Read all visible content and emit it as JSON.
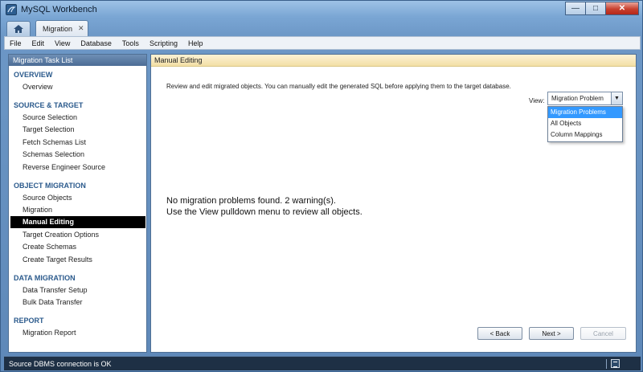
{
  "window": {
    "title": "MySQL Workbench"
  },
  "tabs": {
    "home_icon": "home-icon",
    "document_tab": "Migration",
    "close_glyph": "✕"
  },
  "menu": [
    "File",
    "Edit",
    "View",
    "Database",
    "Tools",
    "Scripting",
    "Help"
  ],
  "sidebar": {
    "header": "Migration Task List",
    "sections": [
      {
        "title": "OVERVIEW",
        "items": [
          "Overview"
        ]
      },
      {
        "title": "SOURCE & TARGET",
        "items": [
          "Source Selection",
          "Target Selection",
          "Fetch Schemas List",
          "Schemas Selection",
          "Reverse Engineer Source"
        ]
      },
      {
        "title": "OBJECT MIGRATION",
        "items": [
          "Source Objects",
          "Migration",
          "Manual Editing",
          "Target Creation Options",
          "Create Schemas",
          "Create Target Results"
        ]
      },
      {
        "title": "DATA MIGRATION",
        "items": [
          "Data Transfer Setup",
          "Bulk Data Transfer"
        ]
      },
      {
        "title": "REPORT",
        "items": [
          "Migration Report"
        ]
      }
    ],
    "active_item": "Manual Editing"
  },
  "main": {
    "header": "Manual Editing",
    "description": "Review and edit migrated objects. You can manually edit the generated SQL before applying them to the target database.",
    "view_label": "View:",
    "view_selected": "Migration Problem",
    "view_options": [
      "Migration Problems",
      "All Objects",
      "Column Mappings"
    ],
    "message_line1": "No migration problems found. 2 warning(s).",
    "message_line2": "Use the View pulldown menu to review all objects.",
    "buttons": {
      "back": "< Back",
      "next": "Next >",
      "cancel": "Cancel"
    }
  },
  "status": {
    "text": "Source DBMS connection is OK"
  }
}
